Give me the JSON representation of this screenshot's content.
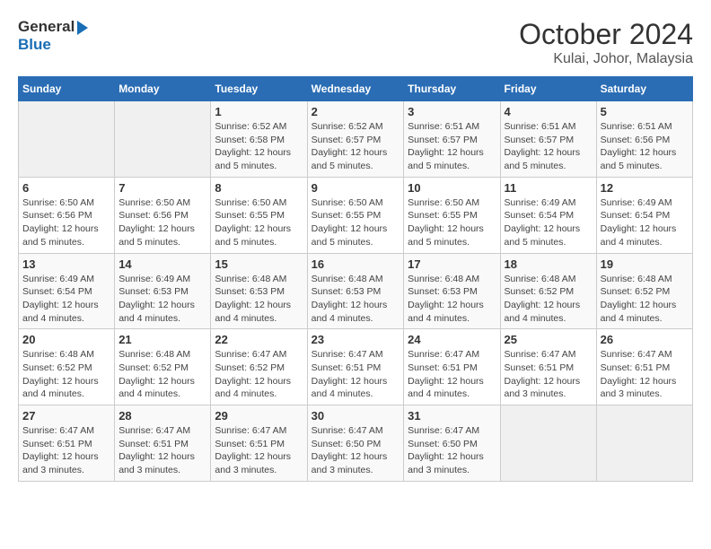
{
  "header": {
    "logo_line1": "General",
    "logo_line2": "Blue",
    "month_year": "October 2024",
    "location": "Kulai, Johor, Malaysia"
  },
  "days_of_week": [
    "Sunday",
    "Monday",
    "Tuesday",
    "Wednesday",
    "Thursday",
    "Friday",
    "Saturday"
  ],
  "weeks": [
    [
      {
        "day": "",
        "info": ""
      },
      {
        "day": "",
        "info": ""
      },
      {
        "day": "1",
        "info": "Sunrise: 6:52 AM\nSunset: 6:58 PM\nDaylight: 12 hours and 5 minutes."
      },
      {
        "day": "2",
        "info": "Sunrise: 6:52 AM\nSunset: 6:57 PM\nDaylight: 12 hours and 5 minutes."
      },
      {
        "day": "3",
        "info": "Sunrise: 6:51 AM\nSunset: 6:57 PM\nDaylight: 12 hours and 5 minutes."
      },
      {
        "day": "4",
        "info": "Sunrise: 6:51 AM\nSunset: 6:57 PM\nDaylight: 12 hours and 5 minutes."
      },
      {
        "day": "5",
        "info": "Sunrise: 6:51 AM\nSunset: 6:56 PM\nDaylight: 12 hours and 5 minutes."
      }
    ],
    [
      {
        "day": "6",
        "info": "Sunrise: 6:50 AM\nSunset: 6:56 PM\nDaylight: 12 hours and 5 minutes."
      },
      {
        "day": "7",
        "info": "Sunrise: 6:50 AM\nSunset: 6:56 PM\nDaylight: 12 hours and 5 minutes."
      },
      {
        "day": "8",
        "info": "Sunrise: 6:50 AM\nSunset: 6:55 PM\nDaylight: 12 hours and 5 minutes."
      },
      {
        "day": "9",
        "info": "Sunrise: 6:50 AM\nSunset: 6:55 PM\nDaylight: 12 hours and 5 minutes."
      },
      {
        "day": "10",
        "info": "Sunrise: 6:50 AM\nSunset: 6:55 PM\nDaylight: 12 hours and 5 minutes."
      },
      {
        "day": "11",
        "info": "Sunrise: 6:49 AM\nSunset: 6:54 PM\nDaylight: 12 hours and 5 minutes."
      },
      {
        "day": "12",
        "info": "Sunrise: 6:49 AM\nSunset: 6:54 PM\nDaylight: 12 hours and 4 minutes."
      }
    ],
    [
      {
        "day": "13",
        "info": "Sunrise: 6:49 AM\nSunset: 6:54 PM\nDaylight: 12 hours and 4 minutes."
      },
      {
        "day": "14",
        "info": "Sunrise: 6:49 AM\nSunset: 6:53 PM\nDaylight: 12 hours and 4 minutes."
      },
      {
        "day": "15",
        "info": "Sunrise: 6:48 AM\nSunset: 6:53 PM\nDaylight: 12 hours and 4 minutes."
      },
      {
        "day": "16",
        "info": "Sunrise: 6:48 AM\nSunset: 6:53 PM\nDaylight: 12 hours and 4 minutes."
      },
      {
        "day": "17",
        "info": "Sunrise: 6:48 AM\nSunset: 6:53 PM\nDaylight: 12 hours and 4 minutes."
      },
      {
        "day": "18",
        "info": "Sunrise: 6:48 AM\nSunset: 6:52 PM\nDaylight: 12 hours and 4 minutes."
      },
      {
        "day": "19",
        "info": "Sunrise: 6:48 AM\nSunset: 6:52 PM\nDaylight: 12 hours and 4 minutes."
      }
    ],
    [
      {
        "day": "20",
        "info": "Sunrise: 6:48 AM\nSunset: 6:52 PM\nDaylight: 12 hours and 4 minutes."
      },
      {
        "day": "21",
        "info": "Sunrise: 6:48 AM\nSunset: 6:52 PM\nDaylight: 12 hours and 4 minutes."
      },
      {
        "day": "22",
        "info": "Sunrise: 6:47 AM\nSunset: 6:52 PM\nDaylight: 12 hours and 4 minutes."
      },
      {
        "day": "23",
        "info": "Sunrise: 6:47 AM\nSunset: 6:51 PM\nDaylight: 12 hours and 4 minutes."
      },
      {
        "day": "24",
        "info": "Sunrise: 6:47 AM\nSunset: 6:51 PM\nDaylight: 12 hours and 4 minutes."
      },
      {
        "day": "25",
        "info": "Sunrise: 6:47 AM\nSunset: 6:51 PM\nDaylight: 12 hours and 3 minutes."
      },
      {
        "day": "26",
        "info": "Sunrise: 6:47 AM\nSunset: 6:51 PM\nDaylight: 12 hours and 3 minutes."
      }
    ],
    [
      {
        "day": "27",
        "info": "Sunrise: 6:47 AM\nSunset: 6:51 PM\nDaylight: 12 hours and 3 minutes."
      },
      {
        "day": "28",
        "info": "Sunrise: 6:47 AM\nSunset: 6:51 PM\nDaylight: 12 hours and 3 minutes."
      },
      {
        "day": "29",
        "info": "Sunrise: 6:47 AM\nSunset: 6:51 PM\nDaylight: 12 hours and 3 minutes."
      },
      {
        "day": "30",
        "info": "Sunrise: 6:47 AM\nSunset: 6:50 PM\nDaylight: 12 hours and 3 minutes."
      },
      {
        "day": "31",
        "info": "Sunrise: 6:47 AM\nSunset: 6:50 PM\nDaylight: 12 hours and 3 minutes."
      },
      {
        "day": "",
        "info": ""
      },
      {
        "day": "",
        "info": ""
      }
    ]
  ]
}
